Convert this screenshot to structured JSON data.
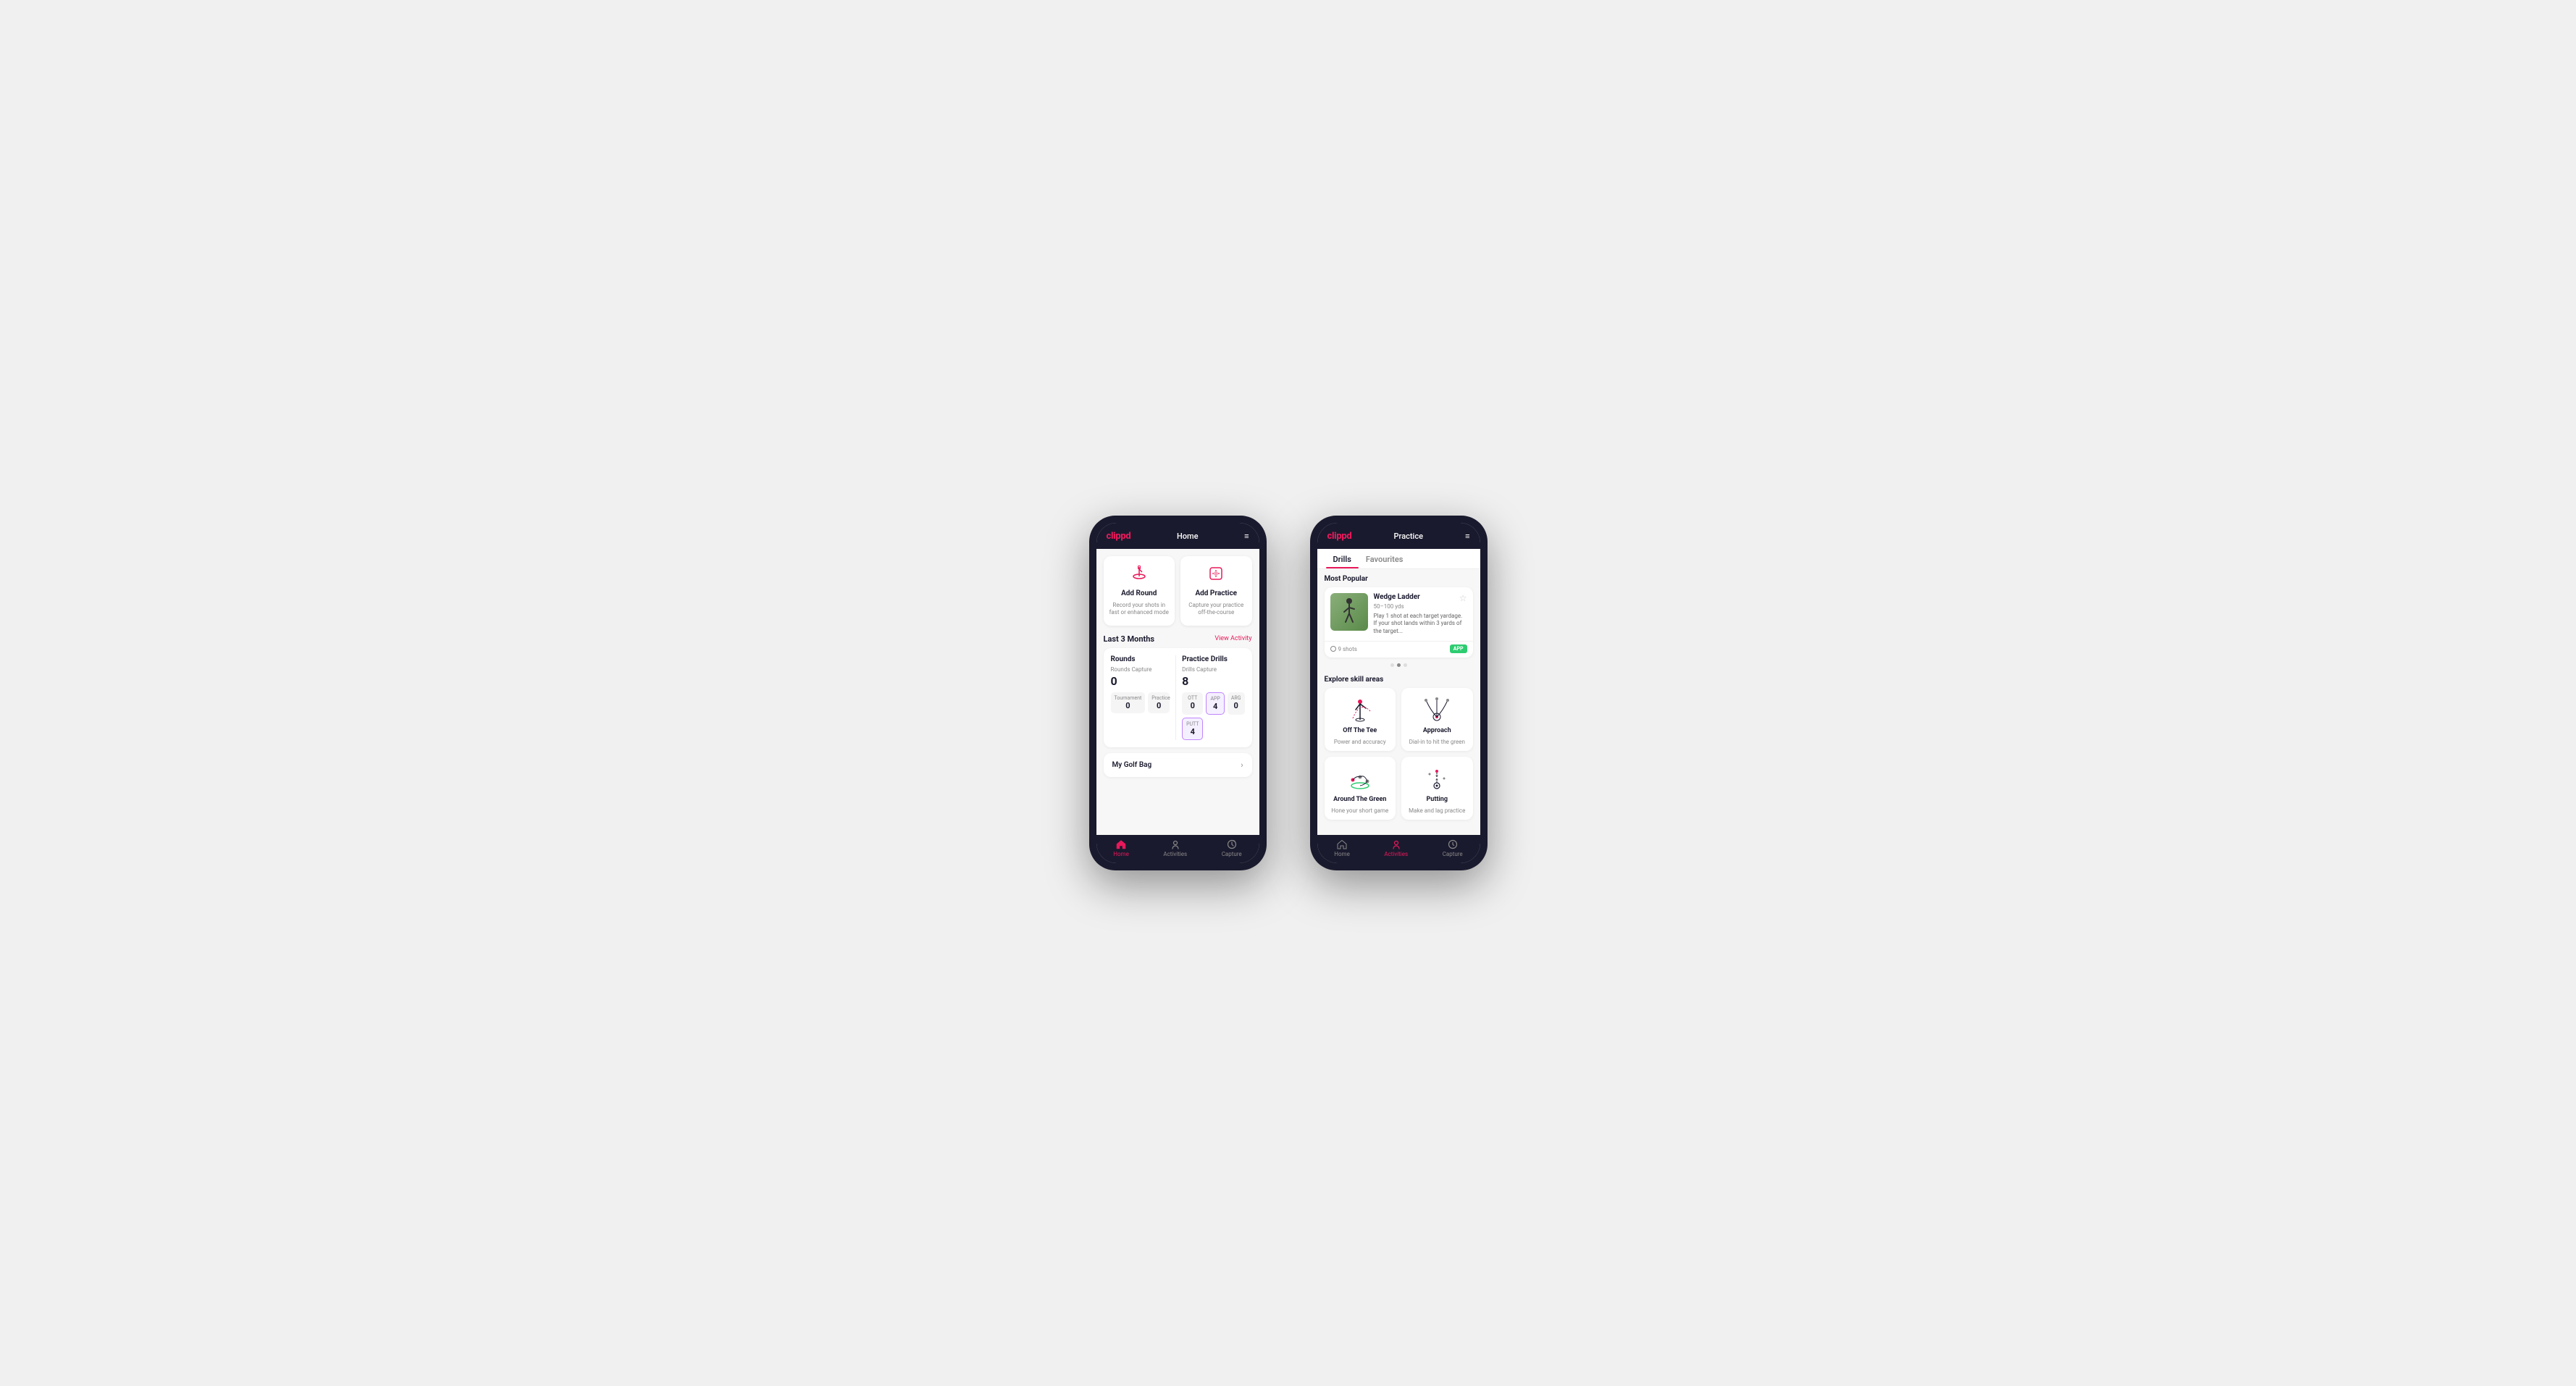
{
  "phone1": {
    "header": {
      "logo": "clippd",
      "title": "Home",
      "menu_icon": "≡"
    },
    "action_cards": [
      {
        "id": "add-round",
        "icon": "⛳",
        "title": "Add Round",
        "desc": "Record your shots in fast or enhanced mode"
      },
      {
        "id": "add-practice",
        "icon": "🎯",
        "title": "Add Practice",
        "desc": "Capture your practice off-the-course"
      }
    ],
    "last3months": {
      "title": "Last 3 Months",
      "link": "View Activity"
    },
    "rounds": {
      "title": "Rounds",
      "capture_label": "Rounds Capture",
      "capture_value": "0",
      "tournament_label": "Tournament",
      "tournament_value": "0",
      "practice_label": "Practice",
      "practice_value": "0"
    },
    "practice_drills": {
      "title": "Practice Drills",
      "capture_label": "Drills Capture",
      "capture_value": "8",
      "ott_label": "OTT",
      "ott_value": "0",
      "app_label": "APP",
      "app_value": "4",
      "arg_label": "ARG",
      "arg_value": "0",
      "putt_label": "PUTT",
      "putt_value": "4"
    },
    "golf_bag": {
      "label": "My Golf Bag"
    },
    "bottom_nav": [
      {
        "id": "home",
        "label": "Home",
        "active": true
      },
      {
        "id": "activities",
        "label": "Activities",
        "active": false
      },
      {
        "id": "capture",
        "label": "Capture",
        "active": false
      }
    ]
  },
  "phone2": {
    "header": {
      "logo": "clippd",
      "title": "Practice",
      "menu_icon": "≡"
    },
    "tabs": [
      {
        "id": "drills",
        "label": "Drills",
        "active": true
      },
      {
        "id": "favourites",
        "label": "Favourites",
        "active": false
      }
    ],
    "most_popular": {
      "title": "Most Popular",
      "drill": {
        "name": "Wedge Ladder",
        "yardage": "50–100 yds",
        "desc": "Play 1 shot at each target yardage. If your shot lands within 3 yards of the target...",
        "shots": "9 shots",
        "badge": "APP"
      }
    },
    "dots": [
      {
        "active": false
      },
      {
        "active": true
      },
      {
        "active": false
      }
    ],
    "explore": {
      "title": "Explore skill areas",
      "skills": [
        {
          "id": "off-the-tee",
          "name": "Off The Tee",
          "desc": "Power and accuracy"
        },
        {
          "id": "approach",
          "name": "Approach",
          "desc": "Dial-in to hit the green"
        },
        {
          "id": "around-the-green",
          "name": "Around The Green",
          "desc": "Hone your short game"
        },
        {
          "id": "putting",
          "name": "Putting",
          "desc": "Make and lag practice"
        }
      ]
    },
    "bottom_nav": [
      {
        "id": "home",
        "label": "Home",
        "active": false
      },
      {
        "id": "activities",
        "label": "Activities",
        "active": true
      },
      {
        "id": "capture",
        "label": "Capture",
        "active": false
      }
    ]
  }
}
